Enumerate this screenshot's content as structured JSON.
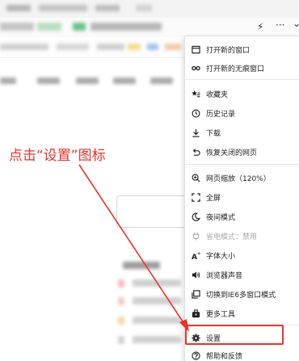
{
  "annotation": {
    "text": "点击“设置”图标"
  },
  "toolbar": {
    "lightning_icon": "⚡",
    "more_icon": "···",
    "chevron_icon": "⌄"
  },
  "menu": {
    "items": [
      {
        "label": "打开新的窗口",
        "icon": "window-icon"
      },
      {
        "label": "打开新的无痕窗口",
        "icon": "incognito-icon"
      },
      {
        "label": "收藏夹",
        "icon": "favorites-icon"
      },
      {
        "label": "历史记录",
        "icon": "history-icon"
      },
      {
        "label": "下载",
        "icon": "download-icon"
      },
      {
        "label": "恢复关闭的网页",
        "icon": "restore-icon"
      },
      {
        "label": "网页缩放（120%）",
        "icon": "zoom-icon"
      },
      {
        "label": "全屏",
        "icon": "fullscreen-icon"
      },
      {
        "label": "夜间模式",
        "icon": "moon-icon"
      },
      {
        "label": "省电模式：禁用",
        "icon": "power-plug-icon",
        "disabled": true
      },
      {
        "label": "字体大小",
        "icon": "font-size-icon"
      },
      {
        "label": "浏览器声音",
        "icon": "speaker-icon"
      },
      {
        "label": "切换到IE6多窗口模式",
        "icon": "ie-window-icon"
      },
      {
        "label": "更多工具",
        "icon": "toolbox-icon"
      },
      {
        "label": "设置",
        "icon": "gear-icon"
      },
      {
        "label": "帮助和反馈",
        "icon": "help-icon"
      }
    ]
  },
  "colors": {
    "annotation_red": "#e8322b",
    "menu_text": "#222222",
    "disabled_text": "#aaaaaa"
  }
}
